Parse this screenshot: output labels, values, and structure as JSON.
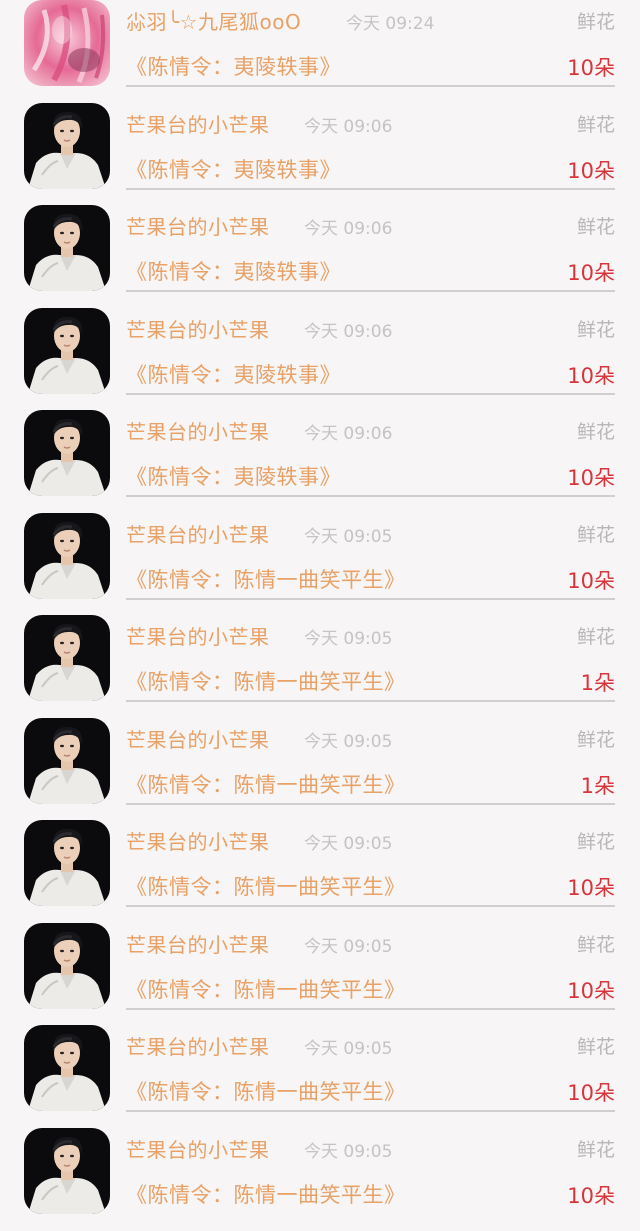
{
  "gift_list": {
    "items": [
      {
        "name": "尛羽╰☆九尾狐ooO",
        "time": "今天 09:24",
        "gift_type": "鲜花",
        "show": "《陈情令：夷陵轶事》",
        "count": "10朵",
        "avatar": "pink-flower"
      },
      {
        "name": "芒果台的小芒果",
        "time": "今天 09:06",
        "gift_type": "鲜花",
        "show": "《陈情令：夷陵轶事》",
        "count": "10朵",
        "avatar": "person-white-shirt"
      },
      {
        "name": "芒果台的小芒果",
        "time": "今天 09:06",
        "gift_type": "鲜花",
        "show": "《陈情令：夷陵轶事》",
        "count": "10朵",
        "avatar": "person-white-shirt"
      },
      {
        "name": "芒果台的小芒果",
        "time": "今天 09:06",
        "gift_type": "鲜花",
        "show": "《陈情令：夷陵轶事》",
        "count": "10朵",
        "avatar": "person-white-shirt"
      },
      {
        "name": "芒果台的小芒果",
        "time": "今天 09:06",
        "gift_type": "鲜花",
        "show": "《陈情令：夷陵轶事》",
        "count": "10朵",
        "avatar": "person-white-shirt"
      },
      {
        "name": "芒果台的小芒果",
        "time": "今天 09:05",
        "gift_type": "鲜花",
        "show": "《陈情令：陈情一曲笑平生》",
        "count": "10朵",
        "avatar": "person-white-shirt"
      },
      {
        "name": "芒果台的小芒果",
        "time": "今天 09:05",
        "gift_type": "鲜花",
        "show": "《陈情令：陈情一曲笑平生》",
        "count": "1朵",
        "avatar": "person-white-shirt"
      },
      {
        "name": "芒果台的小芒果",
        "time": "今天 09:05",
        "gift_type": "鲜花",
        "show": "《陈情令：陈情一曲笑平生》",
        "count": "1朵",
        "avatar": "person-white-shirt"
      },
      {
        "name": "芒果台的小芒果",
        "time": "今天 09:05",
        "gift_type": "鲜花",
        "show": "《陈情令：陈情一曲笑平生》",
        "count": "10朵",
        "avatar": "person-white-shirt"
      },
      {
        "name": "芒果台的小芒果",
        "time": "今天 09:05",
        "gift_type": "鲜花",
        "show": "《陈情令：陈情一曲笑平生》",
        "count": "10朵",
        "avatar": "person-white-shirt"
      },
      {
        "name": "芒果台的小芒果",
        "time": "今天 09:05",
        "gift_type": "鲜花",
        "show": "《陈情令：陈情一曲笑平生》",
        "count": "10朵",
        "avatar": "person-white-shirt"
      },
      {
        "name": "芒果台的小芒果",
        "time": "今天 09:05",
        "gift_type": "鲜花",
        "show": "《陈情令：陈情一曲笑平生》",
        "count": "10朵",
        "avatar": "person-white-shirt"
      }
    ]
  },
  "colors": {
    "background": "#f7f5f6",
    "name_text": "#e8a166",
    "show_text": "#e8a166",
    "muted_text": "#c4c4c4",
    "count_text": "#d9343a",
    "divider": "#cfcfcf"
  }
}
